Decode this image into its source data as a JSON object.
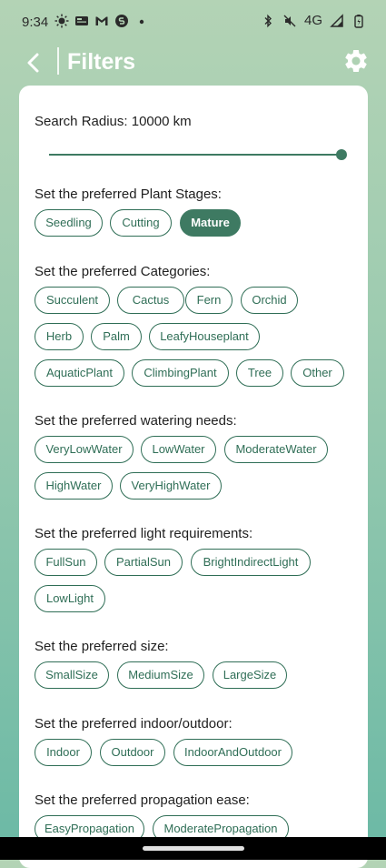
{
  "status_bar": {
    "time": "9:34",
    "network": "4G",
    "left_icons": [
      "weather-icon",
      "news-icon",
      "gmail-icon",
      "shazam-icon",
      "dot-icon"
    ],
    "right_icons": [
      "bluetooth-icon",
      "mute-icon",
      "signal-icon",
      "battery-icon"
    ]
  },
  "app_bar": {
    "title": "Filters"
  },
  "colors": {
    "accent": "#3e7a62",
    "chip_border": "#2f6e56"
  },
  "search_radius": {
    "label": "Search Radius: 10000 km",
    "value_fraction": 1.0
  },
  "sections": {
    "stages": {
      "title": "Set the preferred Plant Stages:",
      "chips": [
        "Seedling",
        "Cutting",
        "Mature"
      ],
      "selected": "Mature"
    },
    "categories": {
      "title": "Set the preferred Categories:",
      "chips": [
        "Succulent",
        "Cactus",
        "Fern",
        "Orchid",
        "Herb",
        "Palm",
        "LeafyHouseplant",
        "AquaticPlant",
        "ClimbingPlant",
        "Tree",
        "Other"
      ]
    },
    "watering": {
      "title": "Set the preferred watering needs:",
      "chips": [
        "VeryLowWater",
        "LowWater",
        "ModerateWater",
        "HighWater",
        "VeryHighWater"
      ]
    },
    "light": {
      "title": "Set the preferred light requirements:",
      "chips": [
        "FullSun",
        "PartialSun",
        "BrightIndirectLight",
        "LowLight"
      ]
    },
    "size": {
      "title": "Set the preferred size:",
      "chips": [
        "SmallSize",
        "MediumSize",
        "LargeSize"
      ]
    },
    "location": {
      "title": "Set the preferred indoor/outdoor:",
      "chips": [
        "Indoor",
        "Outdoor",
        "IndoorAndOutdoor"
      ]
    },
    "propagation": {
      "title": "Set the preferred propagation ease:",
      "chips": [
        "EasyPropagation",
        "ModeratePropagation"
      ]
    }
  }
}
